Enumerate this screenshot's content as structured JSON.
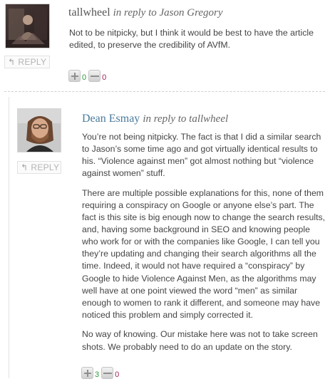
{
  "comments": [
    {
      "author": "tallwheel",
      "in_reply_to": "in reply to Jason Gregory",
      "paragraphs": [
        "Not to be nitpicky, but I think it would be best to have the article edited, to preserve the credibility of AVfM."
      ],
      "reply_label": "REPLY",
      "votes": {
        "up": "0",
        "down": "0"
      }
    },
    {
      "author": "Dean Esmay",
      "in_reply_to": "in reply to tallwheel",
      "paragraphs": [
        "You’re not being nitpicky. The fact is that I did a similar search to Jason’s some time ago and got virtually identical results to his. “Violence against men” got almost nothing but “violence against women” stuff.",
        "There are multiple possible explanations for this, none of them requiring a conspiracy on Google or anyone else’s part. The fact is this site is big enough now to change the search results, and, having some background in SEO and knowing people who work for or with the companies like Google, I can tell you they’re updating and changing their search algorithms all the time. Indeed, it would not have required a “conspiracy” by Google to hide Violence Against Men, as the algorithms may well have at one point viewed the word “men” as similar enough to women to rank it different, and someone may have noticed this problem and simply corrected it.",
        "No way of knowing. Our mistake here was not to take screen shots. We probably need to do an update on the story."
      ],
      "reply_label": "REPLY",
      "votes": {
        "up": "3",
        "down": "0"
      }
    }
  ],
  "icons": {
    "reply": "reply-arrow-icon",
    "vote_up": "plus-icon",
    "vote_down": "minus-icon"
  },
  "colors": {
    "author_link": "#4a7a9c",
    "vote_up_count": "#2e9a3a",
    "vote_down_count": "#a0245a"
  }
}
